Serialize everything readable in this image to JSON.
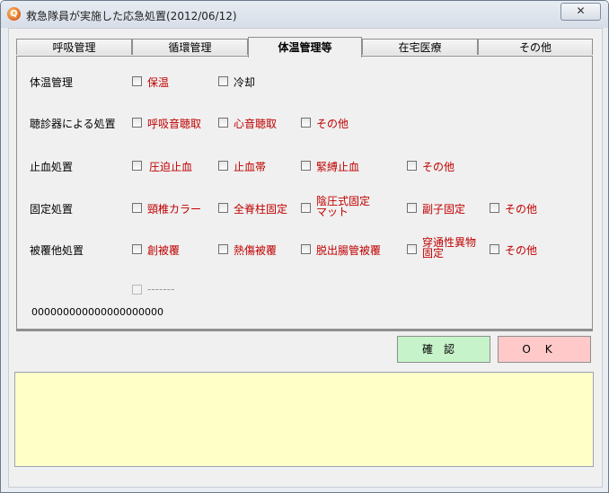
{
  "window": {
    "title": "救急隊員が実施した応急処置(2012/06/12)",
    "app_icon": "Q",
    "close_label": "✕"
  },
  "tabs": [
    {
      "label": "呼吸管理",
      "active": false
    },
    {
      "label": "循環管理",
      "active": false
    },
    {
      "label": "体温管理等",
      "active": true
    },
    {
      "label": "在宅医療",
      "active": false
    },
    {
      "label": "その他",
      "active": false
    }
  ],
  "rows": [
    {
      "label": "体温管理",
      "options": [
        "保温",
        "冷却"
      ]
    },
    {
      "label": "聴診器による処置",
      "options": [
        "呼吸音聴取",
        "心音聴取",
        "その他"
      ]
    },
    {
      "label": "止血処置",
      "options": [
        "圧迫止血",
        "止血帯",
        "緊縛止血",
        "その他"
      ]
    },
    {
      "label": "固定処置",
      "options": [
        "頸椎カラー",
        "全脊柱固定",
        "陰圧式固定マット",
        "副子固定",
        "その他"
      ]
    },
    {
      "label": "被覆他処置",
      "options": [
        "創被覆",
        "熱傷被覆",
        "脱出腸管被覆",
        "穿通性異物固定",
        "その他"
      ]
    }
  ],
  "extra_option": {
    "label": "-------",
    "disabled": true
  },
  "code": "000000000000000000000",
  "buttons": {
    "confirm": "確認",
    "ok": "OK"
  },
  "memo_text": "",
  "colors": {
    "option_red": "#c00000",
    "confirm_bg": "#c6f3c9",
    "ok_bg": "#ffc9c9",
    "memo_bg": "#ffffc8"
  }
}
